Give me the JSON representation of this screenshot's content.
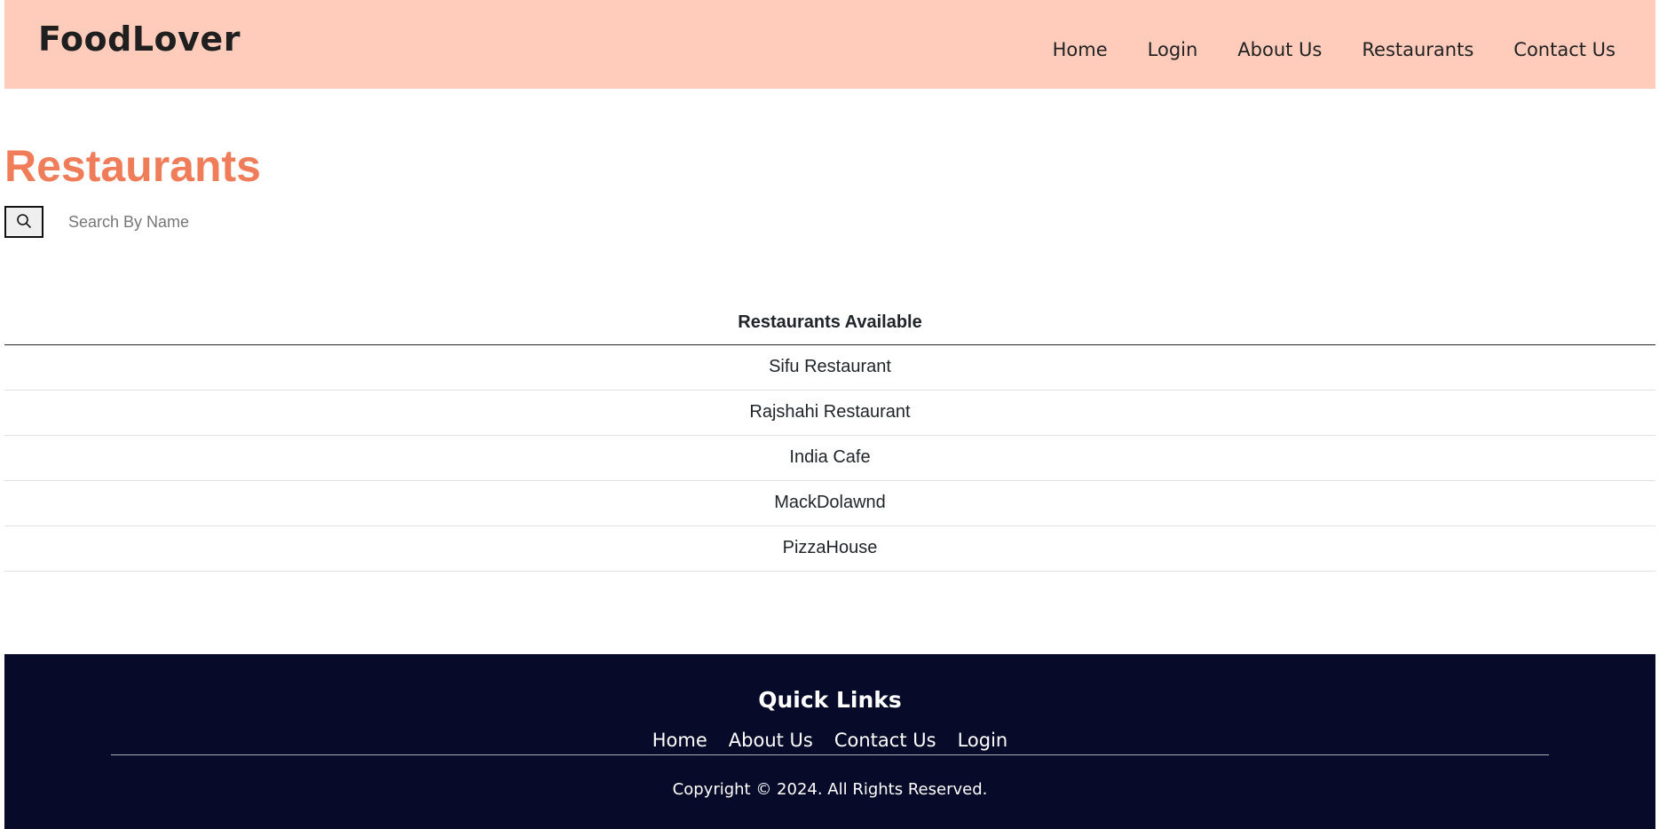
{
  "header": {
    "brand": "FoodLover",
    "nav": [
      "Home",
      "Login",
      "About Us",
      "Restaurants",
      "Contact Us"
    ]
  },
  "main": {
    "title": "Restaurants",
    "search": {
      "placeholder": "Search By Name",
      "value": "",
      "icon": "search-icon"
    },
    "table": {
      "header": "Restaurants Available",
      "rows": [
        "Sifu Restaurant",
        "Rajshahi Restaurant",
        "India Cafe",
        "MackDolawnd",
        "PizzaHouse"
      ]
    }
  },
  "footer": {
    "title": "Quick Links",
    "links": [
      "Home",
      "About Us",
      "Contact Us",
      "Login"
    ],
    "copyright": "Copyright © 2024. All Rights Reserved."
  },
  "colors": {
    "header_bg": "#ffcbbb",
    "title_accent": "#f07d5a",
    "footer_bg": "#070a28"
  }
}
